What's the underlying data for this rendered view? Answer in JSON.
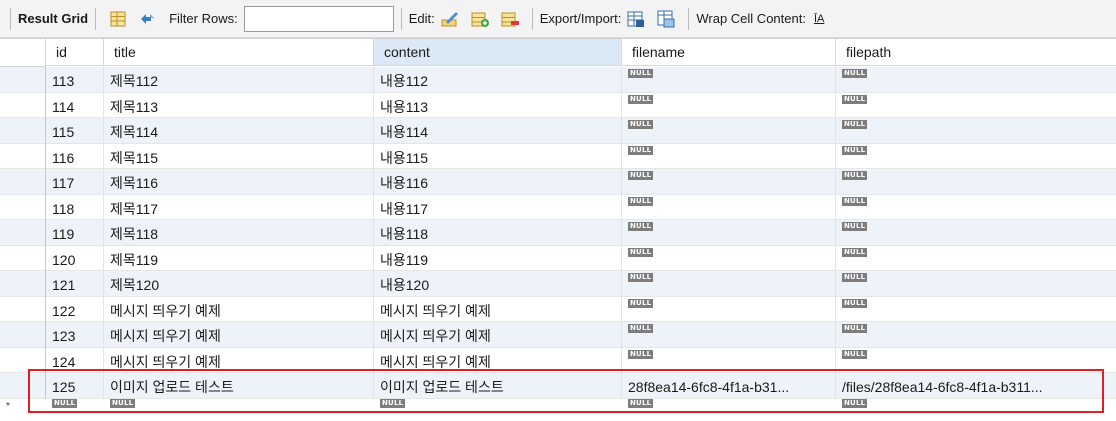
{
  "toolbar": {
    "result_grid_label": "Result Grid",
    "filter_rows_label": "Filter Rows:",
    "filter_value": "",
    "edit_label": "Edit:",
    "export_import_label": "Export/Import:",
    "wrap_label": "Wrap Cell Content:",
    "wrap_icon_glyph": "ĪA"
  },
  "grid": {
    "columns": [
      "id",
      "title",
      "content",
      "filename",
      "filepath"
    ],
    "active_column": "content",
    "null_label": "NULL",
    "rows": [
      {
        "id": "113",
        "title": "제목112",
        "content": "내용112",
        "filename": null,
        "filepath": null
      },
      {
        "id": "114",
        "title": "제목113",
        "content": "내용113",
        "filename": null,
        "filepath": null
      },
      {
        "id": "115",
        "title": "제목114",
        "content": "내용114",
        "filename": null,
        "filepath": null
      },
      {
        "id": "116",
        "title": "제목115",
        "content": "내용115",
        "filename": null,
        "filepath": null
      },
      {
        "id": "117",
        "title": "제목116",
        "content": "내용116",
        "filename": null,
        "filepath": null
      },
      {
        "id": "118",
        "title": "제목117",
        "content": "내용117",
        "filename": null,
        "filepath": null
      },
      {
        "id": "119",
        "title": "제목118",
        "content": "내용118",
        "filename": null,
        "filepath": null
      },
      {
        "id": "120",
        "title": "제목119",
        "content": "내용119",
        "filename": null,
        "filepath": null
      },
      {
        "id": "121",
        "title": "제목120",
        "content": "내용120",
        "filename": null,
        "filepath": null
      },
      {
        "id": "122",
        "title": "메시지 띄우기 예제",
        "content": "메시지 띄우기 예제",
        "filename": null,
        "filepath": null
      },
      {
        "id": "123",
        "title": "메시지 띄우기 예제",
        "content": "메시지 띄우기 예제",
        "filename": null,
        "filepath": null
      },
      {
        "id": "124",
        "title": "메시지 띄우기 예제",
        "content": "메시지 띄우기 예제",
        "filename": null,
        "filepath": null
      },
      {
        "id": "125",
        "title": "이미지 업로드 테스트",
        "content": "이미지 업로드 테스트",
        "filename": "28f8ea14-6fc8-4f1a-b31...",
        "filepath": "/files/28f8ea14-6fc8-4f1a-b311..."
      }
    ],
    "new_row_marker": "*"
  },
  "colors": {
    "highlight_box": "#e02020",
    "active_header": "#dbe8f6",
    "alt_row": "#eef3fa",
    "null_badge": "#7d7d7d"
  },
  "icons": [
    "result-grid-icon",
    "refresh-icon",
    "edit-row-icon",
    "add-row-icon",
    "delete-row-icon",
    "export-icon",
    "import-icon",
    "wrap-cell-icon"
  ]
}
